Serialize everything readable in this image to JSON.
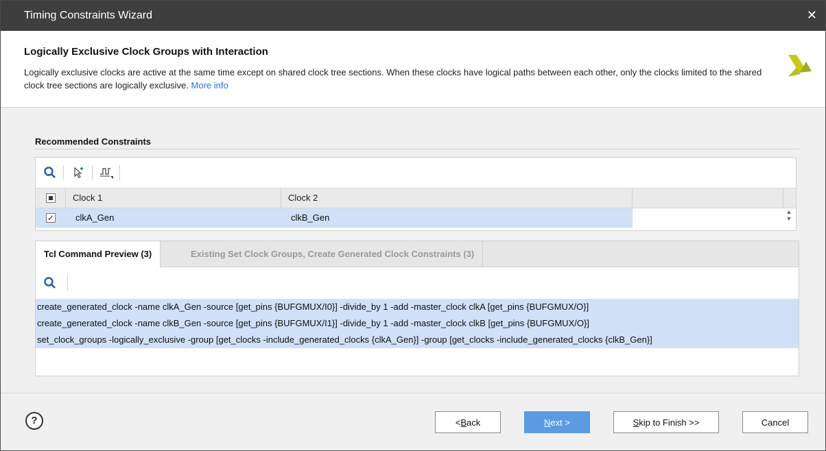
{
  "window": {
    "title": "Timing Constraints Wizard"
  },
  "header": {
    "title": "Logically Exclusive Clock Groups with Interaction",
    "description": "Logically exclusive clocks are active at the same time except on shared clock tree sections. When these clocks have logical paths between each other, only the clocks limited to the shared clock tree sections are logically exclusive.",
    "more_info": "More info"
  },
  "recommended": {
    "section_title": "Recommended Constraints",
    "columns": [
      "Clock 1",
      "Clock 2"
    ],
    "rows": [
      {
        "checked": true,
        "clock1": "clkA_Gen",
        "clock2": "clkB_Gen"
      }
    ]
  },
  "tabs": [
    {
      "label": "Tcl Command Preview (3)",
      "active": true
    },
    {
      "label": "Existing Set Clock Groups, Create Generated Clock Constraints (3)",
      "active": false
    }
  ],
  "tcl": {
    "lines": [
      "create_generated_clock -name clkA_Gen -source [get_pins {BUFGMUX/I0}] -divide_by 1 -add -master_clock clkA [get_pins {BUFGMUX/O}]",
      "create_generated_clock -name clkB_Gen -source [get_pins {BUFGMUX/I1}] -divide_by 1 -add -master_clock clkB [get_pins {BUFGMUX/O}]",
      "set_clock_groups -logically_exclusive -group [get_clocks -include_generated_clocks {clkA_Gen}] -group [get_clocks -include_generated_clocks {clkB_Gen}]"
    ]
  },
  "footer": {
    "back_prefix": "< ",
    "back_mnemonic": "B",
    "back_rest": "ack",
    "next_mnemonic": "N",
    "next_rest": "ext >",
    "skip_mnemonic": "S",
    "skip_rest": "kip to Finish >>",
    "cancel": "Cancel"
  },
  "colors": {
    "titlebar": "#3e3e3e",
    "selection": "#cfe0f7",
    "primary_button": "#5b9be2",
    "link": "#2a6fdb"
  }
}
